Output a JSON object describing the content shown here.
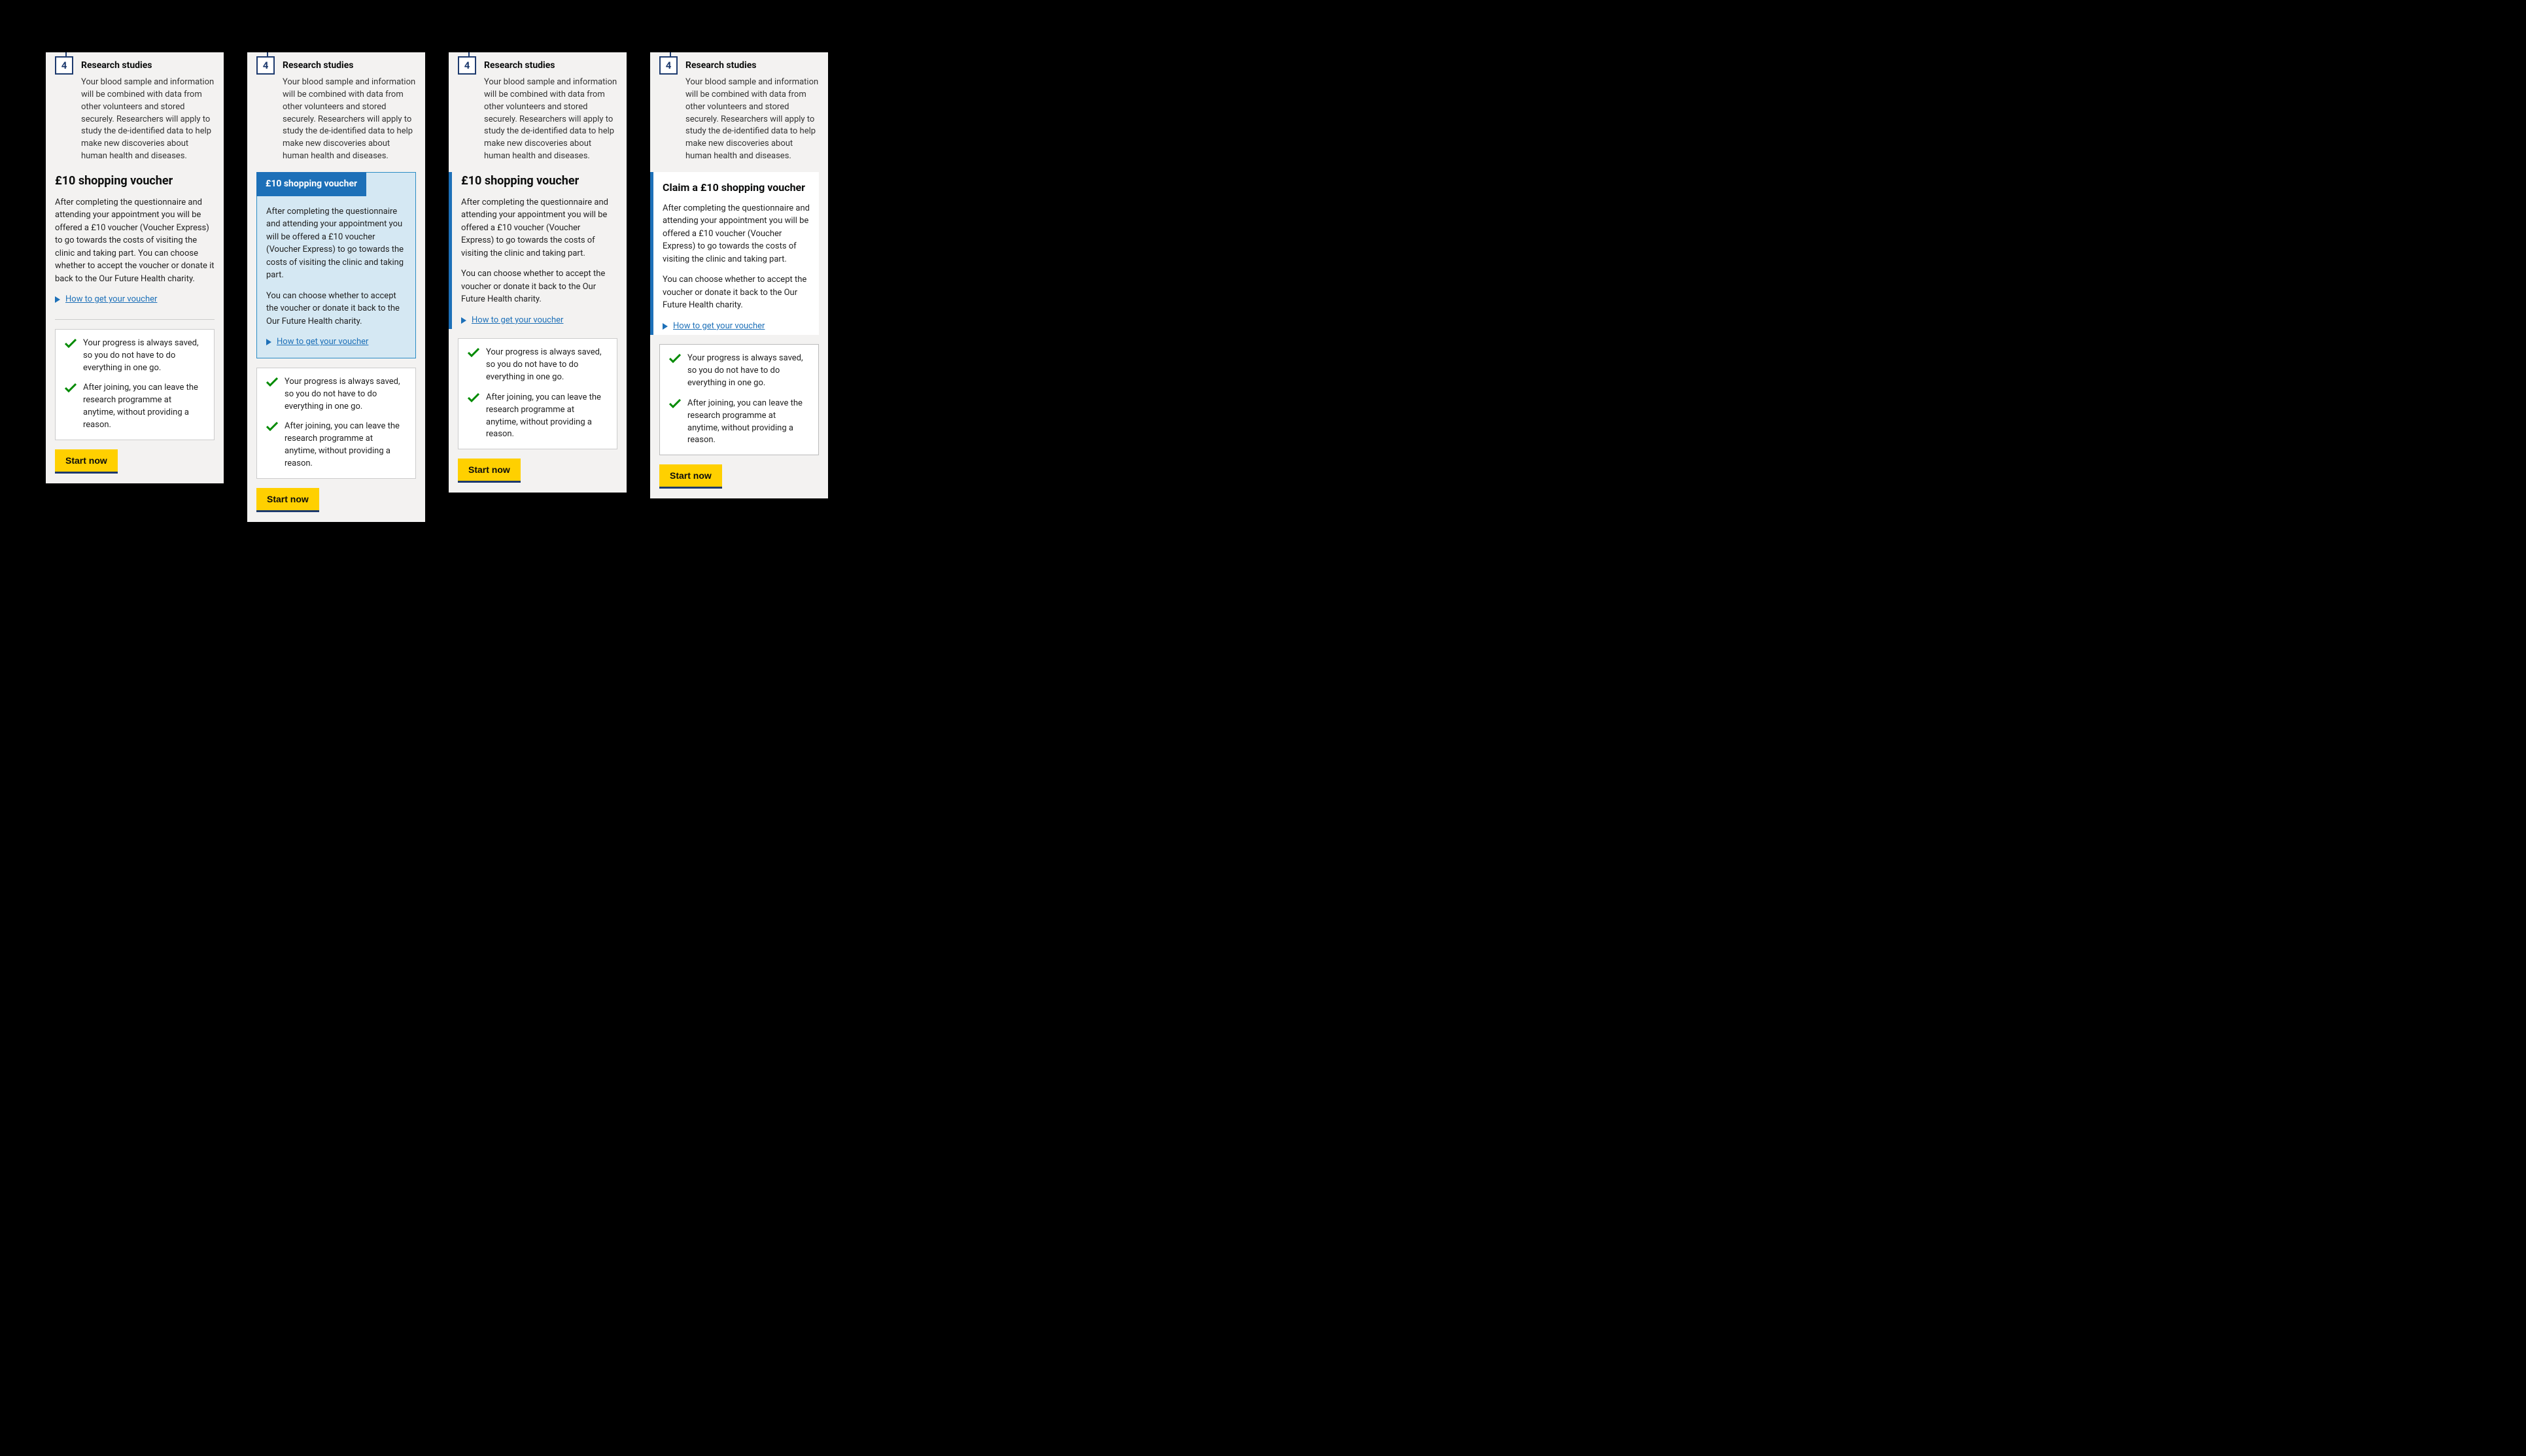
{
  "step": {
    "number": "4",
    "title": "Research studies",
    "body": "Your blood sample and information will be combined with data from other volunteers and stored securely. Researchers will apply to study the de-identified data to help make new discoveries about human health and diseases."
  },
  "voucher": {
    "heading_a": "£10 shopping voucher",
    "heading_b": "£10 shopping voucher",
    "heading_c": "£10 shopping voucher",
    "heading_d": "Claim a £10 shopping voucher",
    "para_single": "After completing the questionnaire and attending your appointment you will be offered a £10 voucher (Voucher Express) to go towards the costs of visiting the clinic and taking part. You can choose whether to accept the voucher or donate it back to the Our Future Health charity.",
    "para_1": "After completing the questionnaire and attending your appointment you will be offered a £10  voucher (Voucher Express) to go towards the costs of visiting the clinic and taking part.",
    "para_2": "You can choose whether to accept the voucher or donate it back to the Our Future Health charity.",
    "link_text": "How to get your voucher"
  },
  "info": {
    "item1": "Your progress is always saved, so you do not have to do everything in one go.",
    "item2": "After joining, you can leave the research programme at anytime, without providing a reason."
  },
  "cta": "Start now",
  "colors": {
    "yellow": "#ffd000",
    "blue": "#1d70b8",
    "navy": "#1d3a6e",
    "green": "#008a00",
    "grey_bg": "#f3f2f1"
  }
}
